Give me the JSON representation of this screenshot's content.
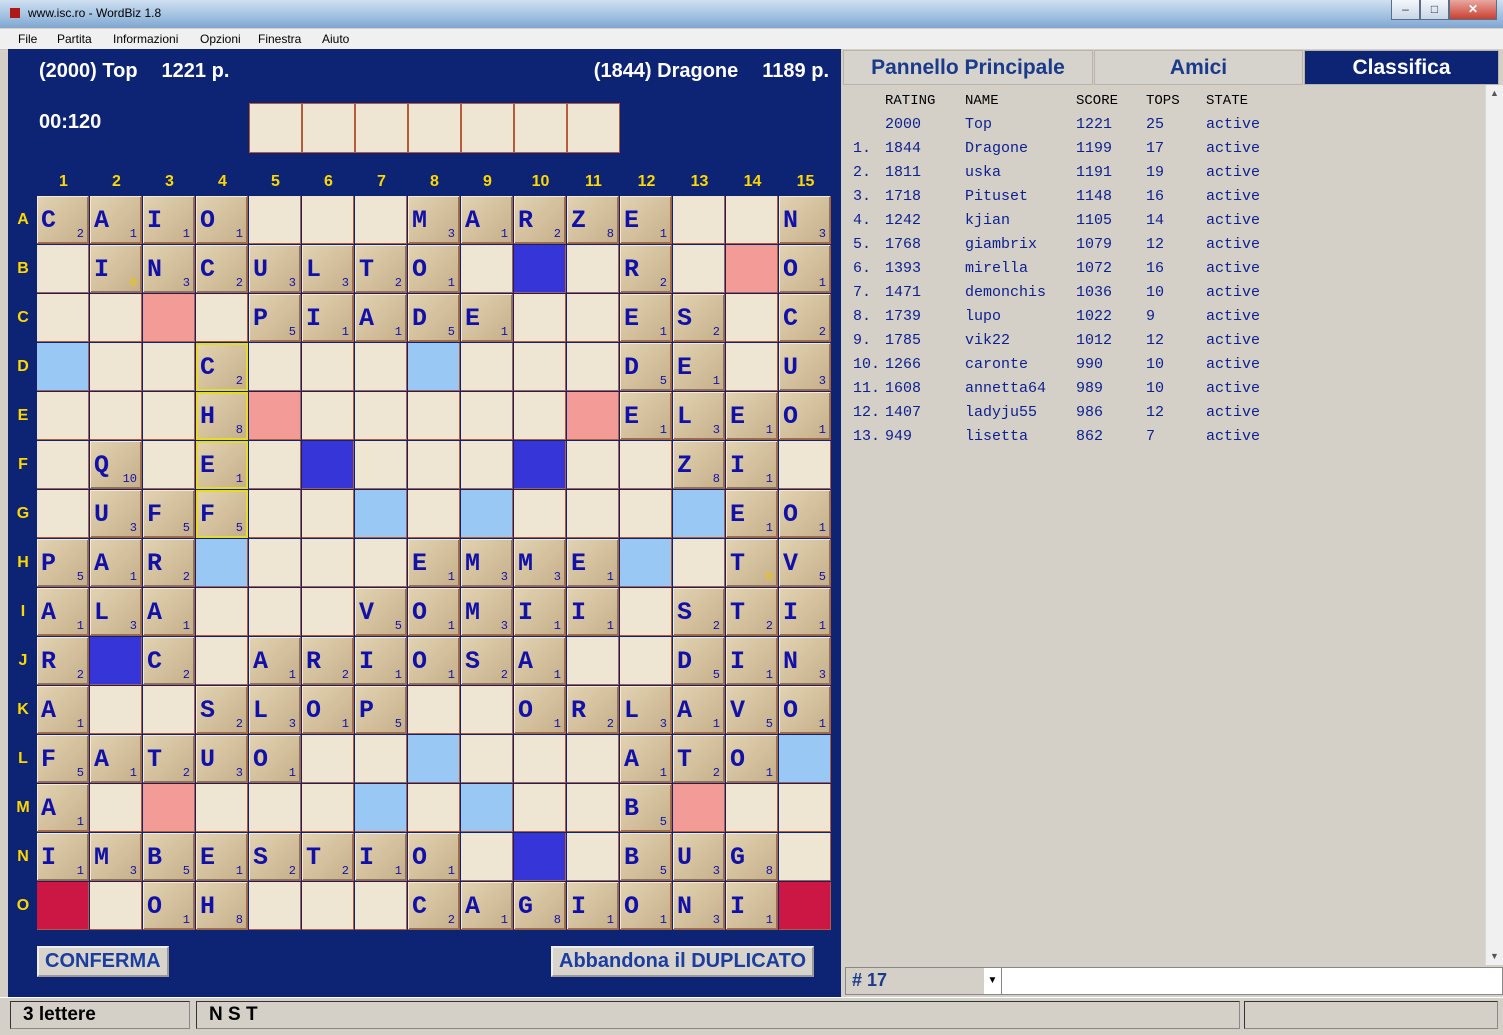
{
  "window": {
    "title": "www.isc.ro - WordBiz 1.8"
  },
  "menu": [
    "File",
    "Partita",
    "Informazioni",
    "Opzioni",
    "Finestra",
    "Aiuto"
  ],
  "players": {
    "left": {
      "label": "(2000) Top",
      "score": "1221 p."
    },
    "right": {
      "label": "(1844) Dragone",
      "score": "1189 p."
    }
  },
  "timer": "00:120",
  "board": {
    "columns": [
      "1",
      "2",
      "3",
      "4",
      "5",
      "6",
      "7",
      "8",
      "9",
      "10",
      "11",
      "12",
      "13",
      "14",
      "15"
    ],
    "rows": [
      "A",
      "B",
      "C",
      "D",
      "E",
      "F",
      "G",
      "H",
      "I",
      "J",
      "K",
      "L",
      "M",
      "N",
      "O"
    ],
    "layout": [
      "C2,A1,I1,O1,.,.,.,M3,A1,R2,Z8,E1,.,.,N3",
      ".,I0,N3,C2,U3,L3,T2,O1,.,#t,.,R2,.,#d,O1",
      ".,.,#d,.,P5,I1,A1,D5,E1,.,.,E1,S2,.,C2",
      "#l,.,.,C2*,.,.,.,#l,.,.,.,D5,E1,.,U3",
      ".,.,.,H8*,#d,.,.,.,.,.,#d,E1,L3,E1,O1",
      ".,Q10,.,E1*,.,#t,.,.,.,#t,.,.,Z8,I1,.",
      ".,U3,F5,F5*,.,.,#l,.,#l,.,.,.,#l,E1,O1",
      "P5,A1,R2,#l,.,.,.,E1,M3,M3,E1,#l,.,T0,V5",
      "A1,L3,A1,.,.,.,V5,O1,M3,I1,I1,.,S2,T2,I1",
      "R2,#t,C2,.,A1,R2,I1,O1,S2,A1,.,.,D5,I1,N3",
      "A1,.,.,S2,L3,O1,P5,.,.,O1,R2,L3,A1,V5,O1",
      "F5,A1,T2,U3,O1,.,.,#l,.,.,.,A1,T2,O1,#l",
      "A1,.,#d,.,.,.,#l,.,#l,.,.,B5,#d,.,.",
      "I1,M3,B5,E1,S2,T2,I1,O1,.,#t,.,B5,U3,G8,.",
      "#w,.,O1,H8,.,.,.,C2,A1,G8,I1,O1,N3,I1,#w"
    ]
  },
  "buttons": {
    "confirm": "CONFERMA",
    "abandon": "Abbandona il DUPLICATO"
  },
  "tabs": [
    "Pannello Principale",
    "Amici",
    "Classifica"
  ],
  "ranking": {
    "headers": {
      "rating": "RATING",
      "name": "NAME",
      "score": "SCORE",
      "tops": "TOPS",
      "state": "STATE"
    },
    "rows": [
      {
        "rank": "",
        "rating": "2000",
        "name": "Top",
        "score": "1221",
        "tops": "25",
        "state": "active"
      },
      {
        "rank": "1.",
        "rating": "1844",
        "name": "Dragone",
        "score": "1199",
        "tops": "17",
        "state": "active"
      },
      {
        "rank": "2.",
        "rating": "1811",
        "name": "uska",
        "score": "1191",
        "tops": "19",
        "state": "active"
      },
      {
        "rank": "3.",
        "rating": "1718",
        "name": "Pituset",
        "score": "1148",
        "tops": "16",
        "state": "active"
      },
      {
        "rank": "4.",
        "rating": "1242",
        "name": "kjian",
        "score": "1105",
        "tops": "14",
        "state": "active"
      },
      {
        "rank": "5.",
        "rating": "1768",
        "name": "giambrix",
        "score": "1079",
        "tops": "12",
        "state": "active"
      },
      {
        "rank": "6.",
        "rating": "1393",
        "name": "mirella",
        "score": "1072",
        "tops": "16",
        "state": "active"
      },
      {
        "rank": "7.",
        "rating": "1471",
        "name": "demonchis",
        "score": "1036",
        "tops": "10",
        "state": "active"
      },
      {
        "rank": "8.",
        "rating": "1739",
        "name": "lupo",
        "score": "1022",
        "tops": "9",
        "state": "active"
      },
      {
        "rank": "9.",
        "rating": "1785",
        "name": "vik22",
        "score": "1012",
        "tops": "12",
        "state": "active"
      },
      {
        "rank": "10.",
        "rating": "1266",
        "name": "caronte",
        "score": "990",
        "tops": "10",
        "state": "active"
      },
      {
        "rank": "11.",
        "rating": "1608",
        "name": "annetta64",
        "score": "989",
        "tops": "10",
        "state": "active"
      },
      {
        "rank": "12.",
        "rating": "1407",
        "name": "ladyju55",
        "score": "986",
        "tops": "12",
        "state": "active"
      },
      {
        "rank": "13.",
        "rating": "949",
        "name": "lisetta",
        "score": "862",
        "tops": "7",
        "state": "active"
      }
    ]
  },
  "round_select": "# 17",
  "status": {
    "letters": "3 lettere",
    "rack_letters": "N S T"
  }
}
